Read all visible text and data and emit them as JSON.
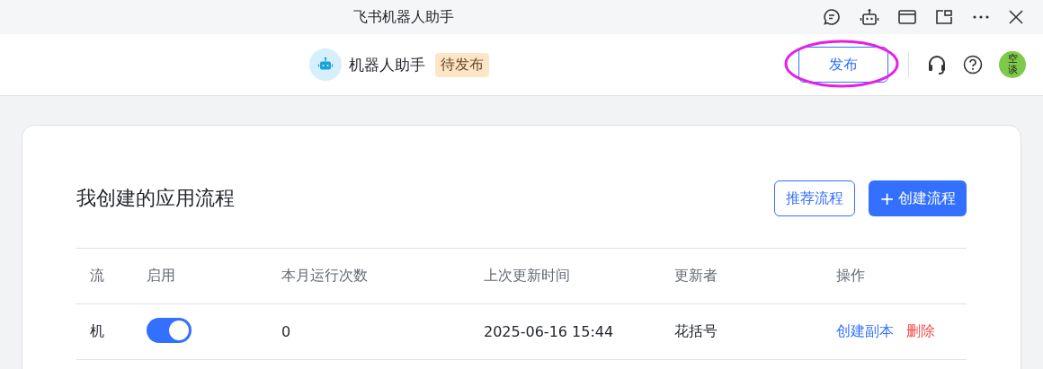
{
  "window": {
    "title": "飞书机器人助手"
  },
  "header": {
    "app_name": "机器人助手",
    "status_badge": "待发布",
    "publish_button": "发布",
    "avatar_text": "空谈",
    "publish_highlighted": true
  },
  "section": {
    "title": "我创建的应用流程",
    "buttons": [
      {
        "kind": "outline",
        "label": "推荐流程"
      },
      {
        "kind": "primary",
        "icon": "+",
        "label": "创建流程"
      }
    ]
  },
  "table": {
    "columns": [
      "流",
      "启用",
      "本月运行次数",
      "上次更新时间",
      "更新者",
      "操作"
    ],
    "rows": [
      {
        "name": "机",
        "enabled": true,
        "runs": "0",
        "updated": "2025-06-16 15:44",
        "updater": "花括号",
        "actions": [
          {
            "kind": "link",
            "label": "创建副本"
          },
          {
            "kind": "danger",
            "label": "删除"
          }
        ]
      }
    ]
  }
}
